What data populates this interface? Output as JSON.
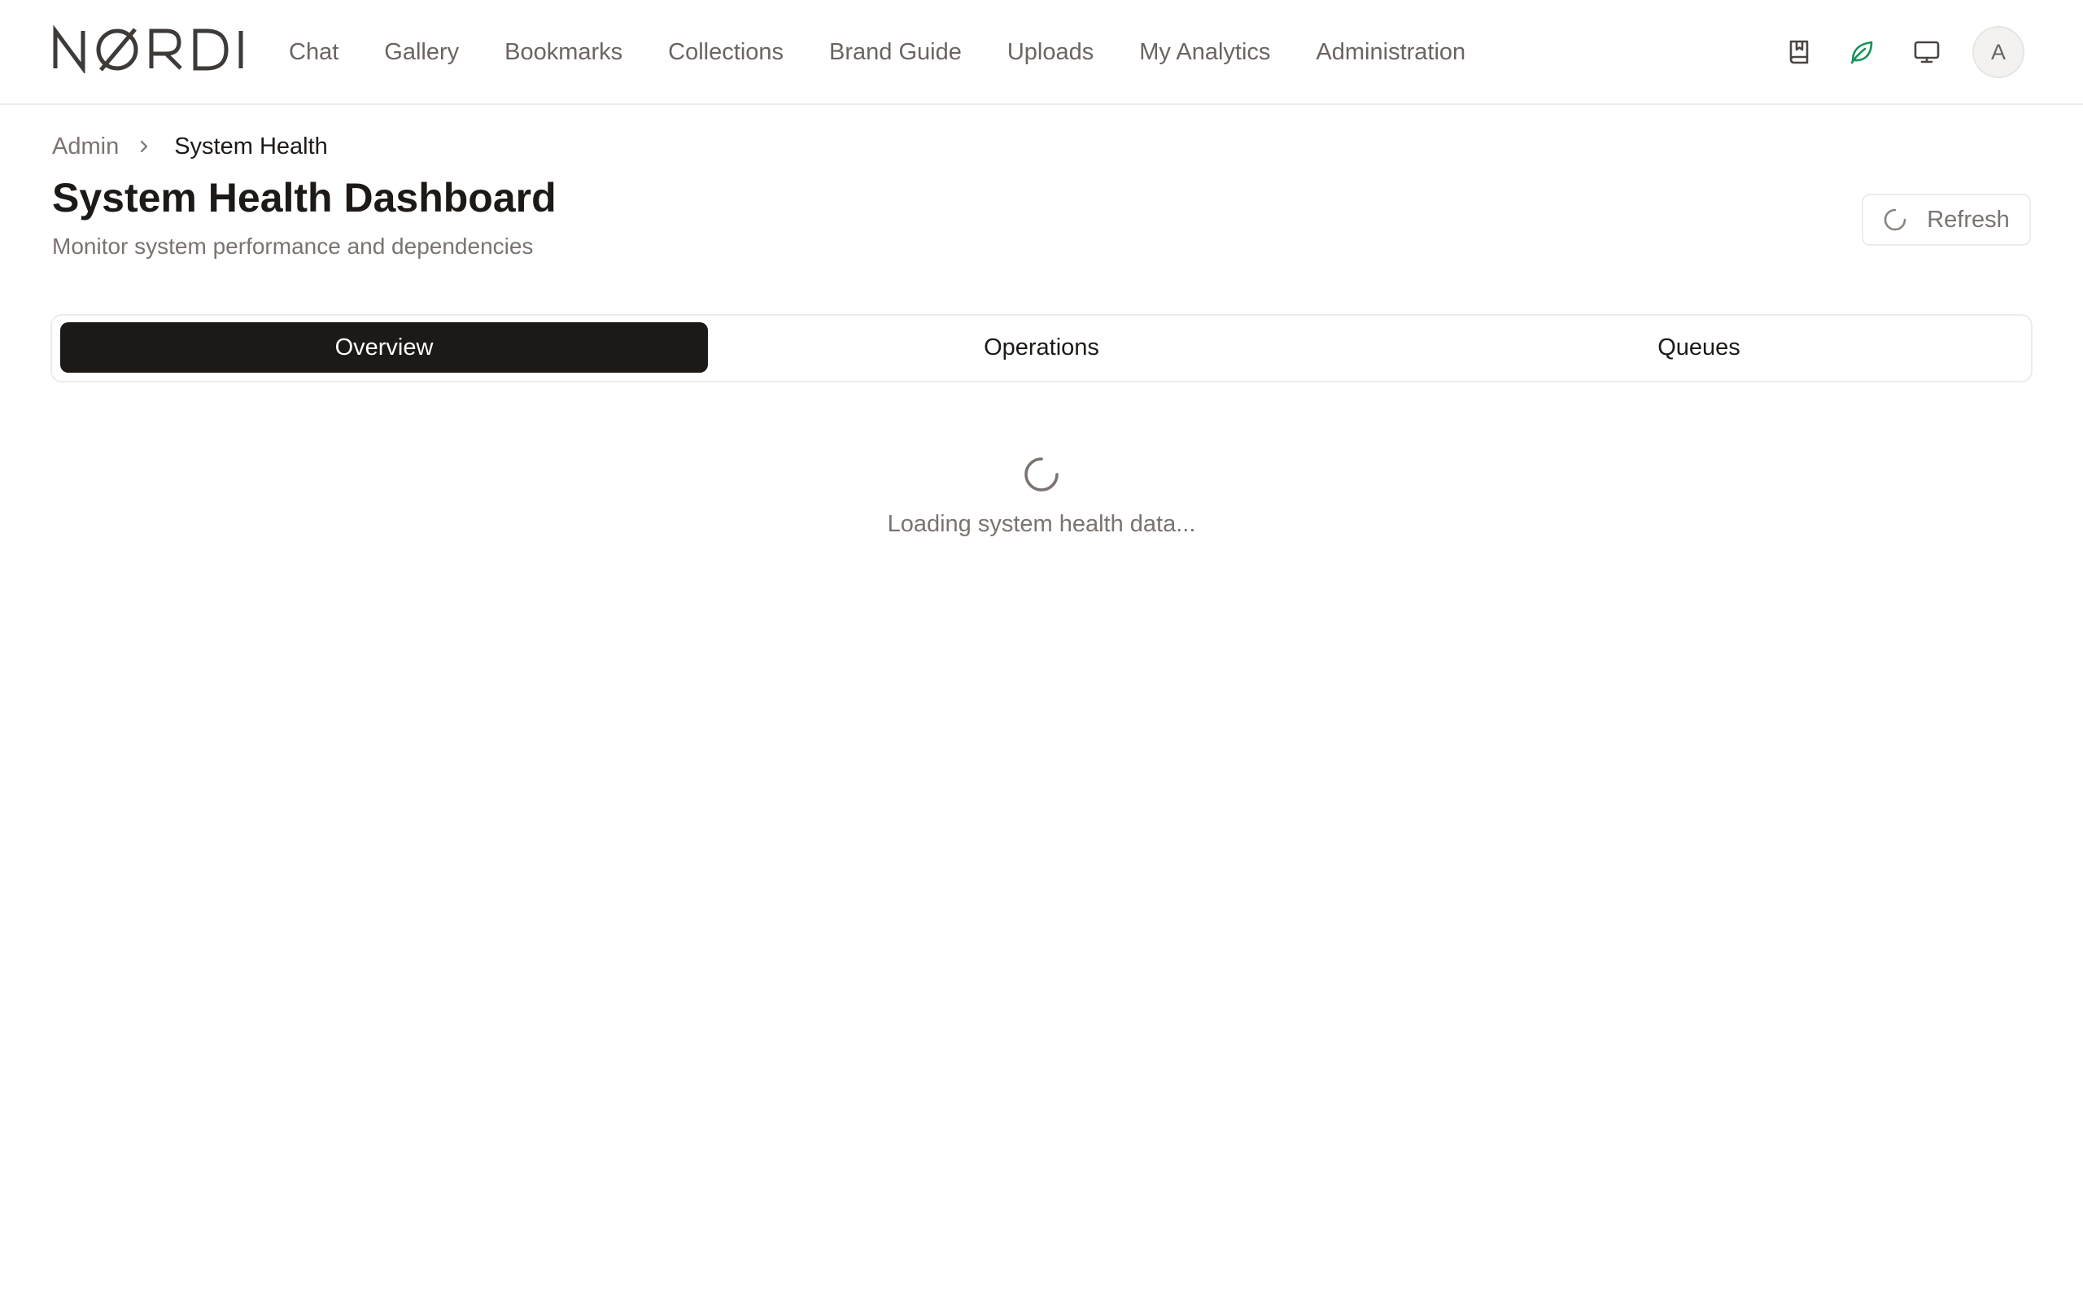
{
  "brand": {
    "logo_text": "NØRDI"
  },
  "nav": {
    "items": [
      {
        "label": "Chat"
      },
      {
        "label": "Gallery"
      },
      {
        "label": "Bookmarks"
      },
      {
        "label": "Collections"
      },
      {
        "label": "Brand Guide"
      },
      {
        "label": "Uploads"
      },
      {
        "label": "My Analytics"
      },
      {
        "label": "Administration"
      }
    ]
  },
  "header_icons": {
    "bookmark": "bookmark-icon",
    "leaf": "leaf-icon",
    "monitor": "monitor-icon",
    "leaf_color": "#15935a"
  },
  "user": {
    "avatar_initial": "A"
  },
  "breadcrumb": {
    "parent": "Admin",
    "current": "System Health"
  },
  "page": {
    "title": "System Health Dashboard",
    "subtitle": "Monitor system performance and dependencies"
  },
  "actions": {
    "refresh_label": "Refresh"
  },
  "tabs": [
    {
      "label": "Overview",
      "active": true
    },
    {
      "label": "Operations",
      "active": false
    },
    {
      "label": "Queues",
      "active": false
    }
  ],
  "status": {
    "loading_text": "Loading system health data..."
  },
  "colors": {
    "active_tab_bg": "#1c1917",
    "muted_text": "#7a7370",
    "border": "#ececea"
  }
}
